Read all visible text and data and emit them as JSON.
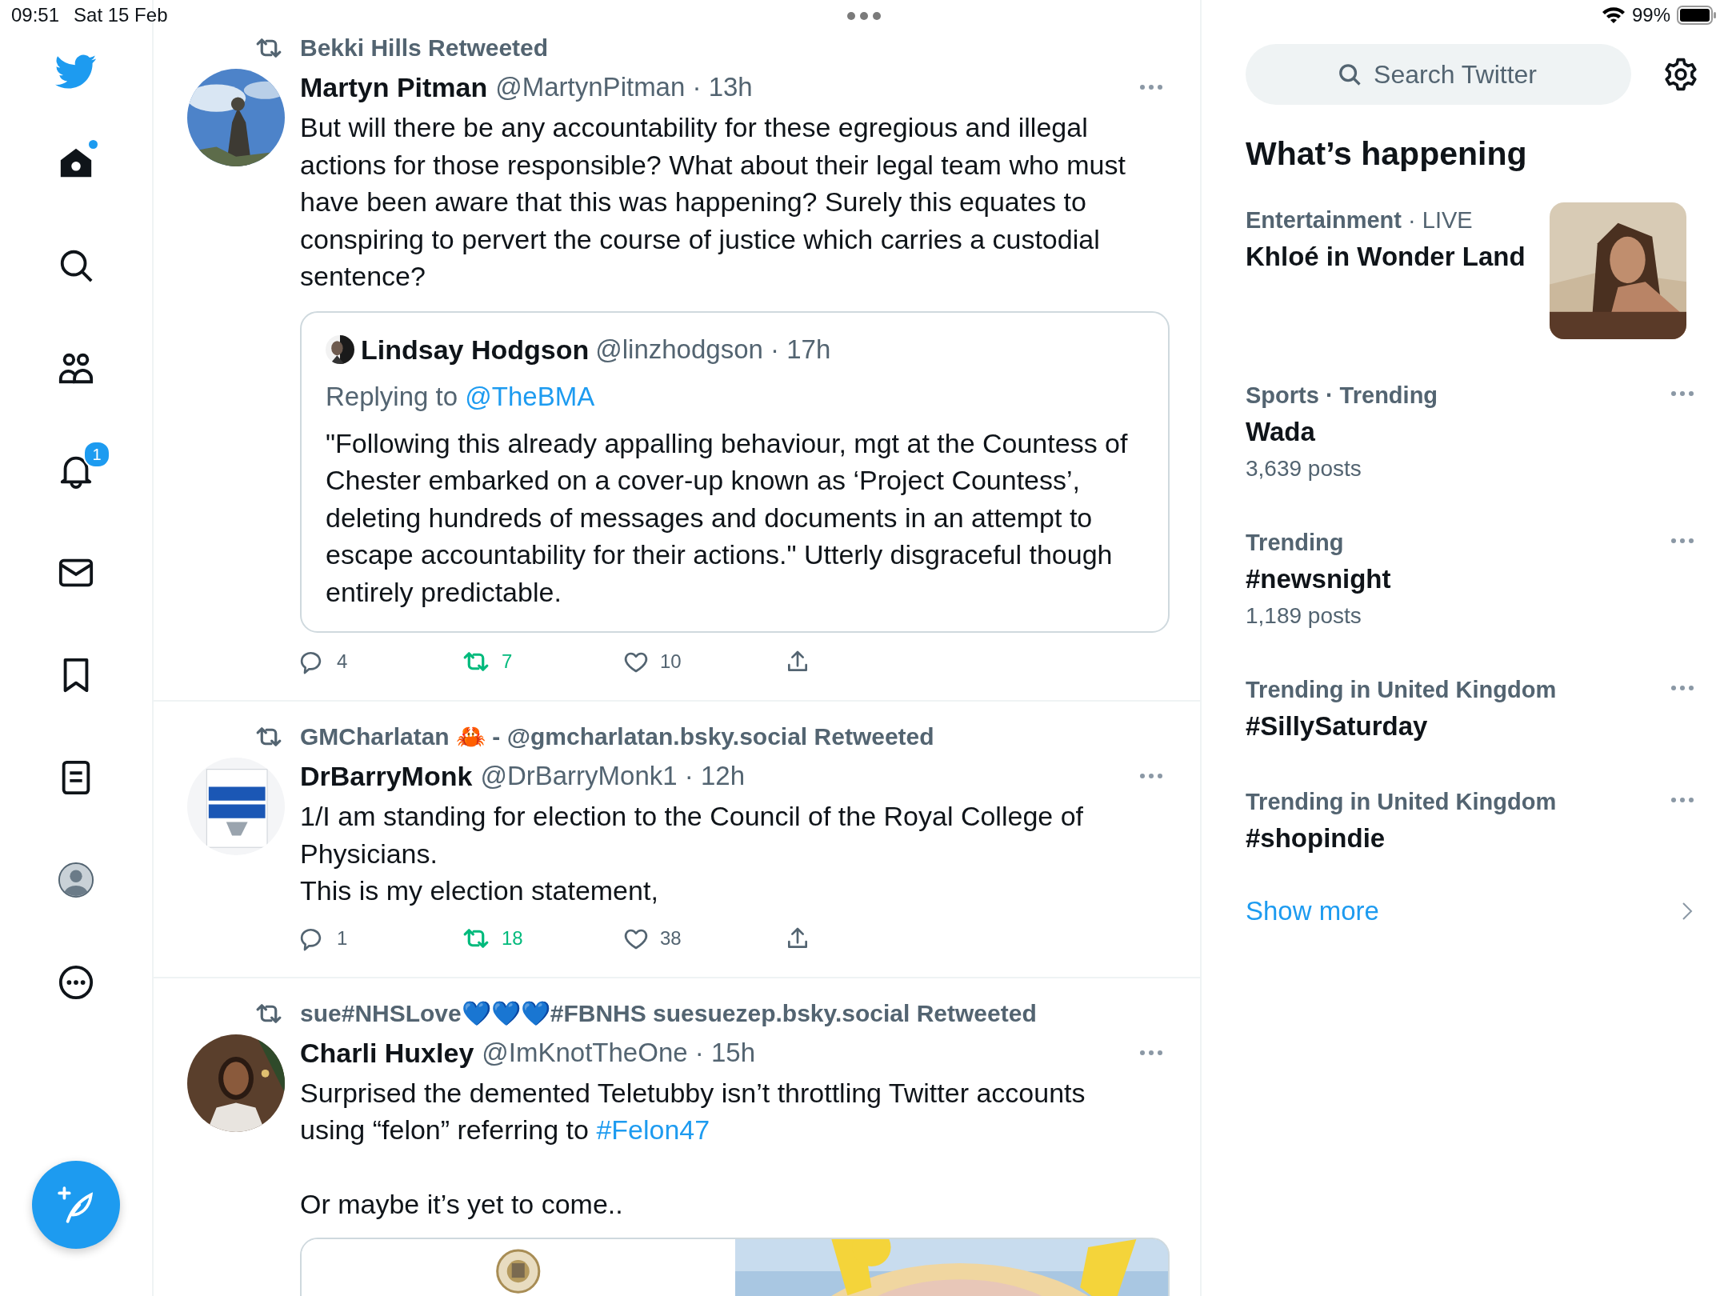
{
  "status_bar": {
    "time": "09:51",
    "date": "Sat 15 Feb",
    "battery": "99%"
  },
  "nav": {
    "items": [
      {
        "kind": "home",
        "selected": true,
        "dot": true
      },
      {
        "kind": "search",
        "selected": false,
        "dot": false
      },
      {
        "kind": "communities",
        "selected": false,
        "dot": false
      },
      {
        "kind": "notifications",
        "selected": false,
        "dot": false,
        "badge": "1"
      },
      {
        "kind": "messages",
        "selected": false,
        "dot": false
      },
      {
        "kind": "bookmarks",
        "selected": false,
        "dot": false
      },
      {
        "kind": "lists",
        "selected": false,
        "dot": false
      },
      {
        "kind": "profile",
        "selected": false,
        "dot": false
      },
      {
        "kind": "more",
        "selected": false,
        "dot": false
      }
    ]
  },
  "tweets": [
    {
      "retweeted_by": "Bekki Hills Retweeted",
      "name": "Martyn Pitman",
      "handle": "@MartynPitman",
      "time": "· 13h",
      "paragraphs": [
        [
          {
            "text": "But will there be any accountability for these egregious and illegal actions for those responsible? What about their legal team who must have been aware that this was happening? Surely this equates to conspiring to pervert the course of justice which carries a custodial sentence?"
          }
        ]
      ],
      "quote": {
        "name": "Lindsay Hodgson",
        "handle": "@linzhodgson",
        "time": "· 17h",
        "replying_label": "Replying to",
        "replying_to": "@TheBMA",
        "text": "\"Following this already appalling behaviour, mgt at the Countess of Chester embarked on a cover-up known as ‘Project Countess’, deleting hundreds of messages and documents in an attempt to escape accountability for their actions.\" Utterly disgraceful though entirely predictable."
      },
      "replies": "4",
      "retweets": "7",
      "likes": "10",
      "retweeted": true,
      "liked": false
    },
    {
      "retweeted_by": "GMCharlatan 🦀 - @gmcharlatan.bsky.social Retweeted",
      "name": "DrBarryMonk",
      "handle": "@DrBarryMonk1",
      "time": "· 12h",
      "paragraphs": [
        [
          {
            "text": "1/I am standing for election to the Council of the Royal College of Physicians."
          }
        ],
        [
          {
            "text": "This is my election statement,"
          }
        ]
      ],
      "replies": "1",
      "retweets": "18",
      "likes": "38",
      "retweeted": true,
      "liked": false
    },
    {
      "retweeted_by": "sue#NHSLove💙💙💙#FBNHS suesuezep.bsky.social Retweeted",
      "name": "Charli Huxley",
      "handle": "@ImKnotTheOne",
      "time": "· 15h",
      "paragraphs": [
        [
          {
            "text": "Surprised the demented Teletubby isn’t throttling Twitter accounts using “felon” referring to "
          },
          {
            "text": "#Felon47",
            "kind": "link"
          }
        ],
        [
          {
            "text": "Or maybe it’s yet to come.."
          }
        ]
      ],
      "media": [
        {
          "kind": "picture"
        },
        {
          "kind": "picture"
        }
      ]
    }
  ],
  "search": {
    "placeholder": "Search Twitter"
  },
  "trends": {
    "title": "What’s happening",
    "items": [
      {
        "category": "**Entertainment** · LIVE",
        "title": "Khloé in Wonder Land",
        "kind": "picture"
      },
      {
        "category": "**Sports · Trending**",
        "title": "Wada",
        "posts": "3,639 posts",
        "kind": "menu"
      },
      {
        "category": "**Trending**",
        "title": "#newsnight",
        "posts": "1,189 posts",
        "kind": "menu"
      },
      {
        "category": "**Trending in United Kingdom**",
        "title": "#SillySaturday",
        "kind": "menu"
      },
      {
        "category": "**Trending in United Kingdom**",
        "title": "#shopindie",
        "kind": "menu"
      }
    ],
    "show_more": "Show more"
  }
}
